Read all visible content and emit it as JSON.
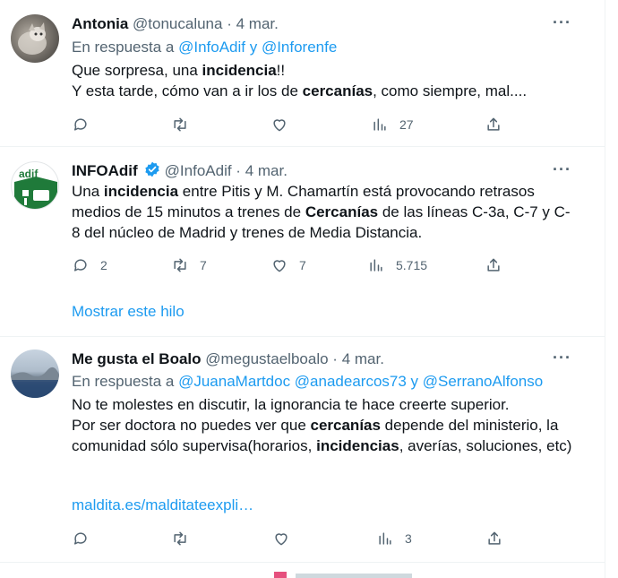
{
  "tweets": [
    {
      "name": "Antonia",
      "handle": "@tonucaluna",
      "dot": "·",
      "time": "4 mar.",
      "reply_prefix": "En respuesta a",
      "reply_targets": "@InfoAdif y @Inforenfe",
      "line1_pre": "Que sorpresa, una ",
      "line1_bold": "incidencia",
      "line1_post": "!!",
      "line2_pre": "Y esta tarde, cómo van a ir los de ",
      "line2_bold": "cercanías",
      "line2_post": ", como siempre, mal....",
      "views": "27"
    },
    {
      "name": "INFOAdif",
      "handle": "@InfoAdif",
      "dot": "·",
      "time": "4 mar.",
      "logo_text": "adif",
      "t1": "Una ",
      "b1": "incidencia",
      "t2": " entre Pitis y M. Chamartín está provocando retrasos medios de 15 minutos a trenes de ",
      "b2": "Cercanías",
      "t3": " de las líneas C-3a, C-7 y C-8 del núcleo de Madrid y trenes de  Media Distancia.",
      "replies": "2",
      "retweets": "7",
      "likes": "7",
      "views": "5.715",
      "show_thread": "Mostrar este hilo"
    },
    {
      "name": "Me gusta el Boalo",
      "handle": "@megustaelboalo",
      "dot": "·",
      "time": "4 mar.",
      "reply_prefix": "En respuesta a",
      "reply_targets": "@JuanaMartdoc @anadearcos73 y @SerranoAlfonso",
      "line1": "No te molestes en discutir, la ignorancia te hace creerte superior.",
      "t1": "Por ser doctora no puedes ver que ",
      "b1": "cercanías",
      "t2": " depende del ministerio,  la comunidad sólo supervisa(horarios, ",
      "b2": "incidencias",
      "t3": ", averías, soluciones, etc)",
      "link": "maldita.es/malditateexpli…",
      "views": "3"
    }
  ],
  "more_label": "···",
  "colors": {
    "accent": "#1d9bf0",
    "muted": "#536471",
    "adif_green": "#1f7a3a"
  }
}
